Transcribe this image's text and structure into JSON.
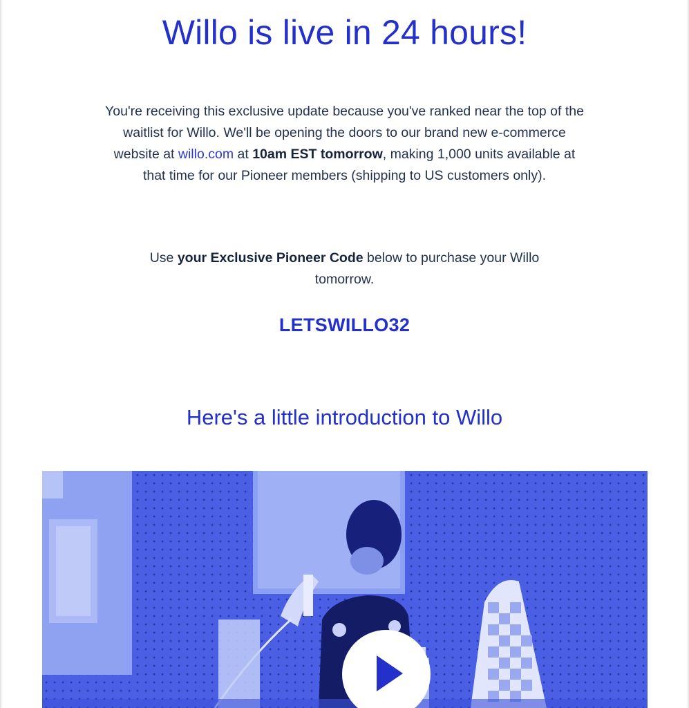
{
  "email": {
    "headline": "Willo is live in 24 hours!",
    "intro": {
      "part1": "You're receiving this exclusive update because you've ranked near the top of the waitlist for Willo. We'll be opening the doors to our brand new e-commerce website at ",
      "link_text": "willo.com",
      "part2": " at ",
      "bold_time": "10am EST tomorrow",
      "part3": ", making 1,000 units available at that time for our Pioneer members (shipping to US customers only)."
    },
    "code_prompt": {
      "part1": "Use ",
      "bold": "your Exclusive Pioneer Code",
      "part2": " below to purchase your Willo tomorrow."
    },
    "promo_code": "LETSWILLO32",
    "video_heading": "Here's a little introduction to Willo",
    "video": {
      "play_icon": "play-icon",
      "tint_color": "#4f63e6"
    },
    "colors": {
      "accent": "#2330c9",
      "body_text": "#22324d",
      "link": "#2b39d4"
    }
  }
}
